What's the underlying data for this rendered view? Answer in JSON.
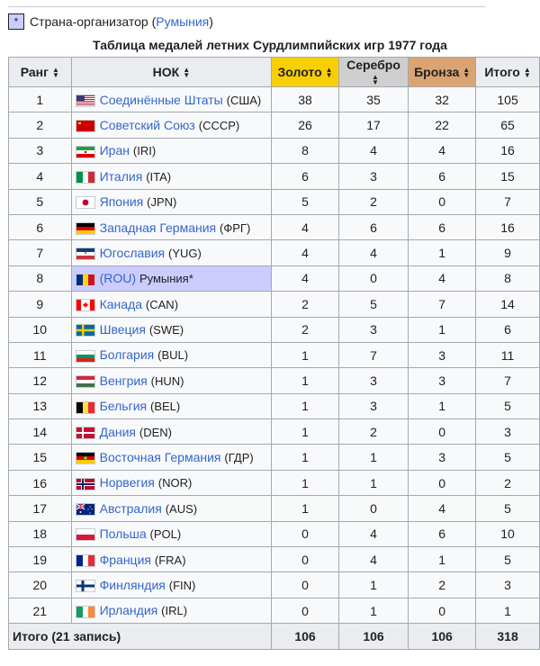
{
  "legend": {
    "symbol": "*",
    "text": "Страна-организатор (",
    "link": "Румыния",
    "close": ")"
  },
  "caption": "Таблица медалей летних Сурдлимпийских игр 1977 года",
  "headers": {
    "rank": "Ранг",
    "noc": "НОК",
    "gold": "Золото",
    "silver": "Серебро",
    "bronze": "Бронза",
    "total": "Итого"
  },
  "colors": {
    "gold": "#f7cf02",
    "silver": "#cfcfcf",
    "bronze": "#d9a472",
    "host": "#ccccff",
    "link": "#3366cc"
  },
  "rows": [
    {
      "rank": "1",
      "name": "Соединённые Штаты",
      "code": "(США)",
      "flag": "flag-usa",
      "gold": "38",
      "silver": "35",
      "bronze": "32",
      "total": "105"
    },
    {
      "rank": "2",
      "name": "Советский Союз",
      "code": "(СССР)",
      "flag": "flag-ussr",
      "gold": "26",
      "silver": "17",
      "bronze": "22",
      "total": "65"
    },
    {
      "rank": "3",
      "name": "Иран",
      "code": "(IRI)",
      "flag": "flag-iran",
      "gold": "8",
      "silver": "4",
      "bronze": "4",
      "total": "16"
    },
    {
      "rank": "4",
      "name": "Италия",
      "code": "(ITA)",
      "flag": "flag-italy",
      "gold": "6",
      "silver": "3",
      "bronze": "6",
      "total": "15"
    },
    {
      "rank": "5",
      "name": "Япония",
      "code": "(JPN)",
      "flag": "flag-japan",
      "gold": "5",
      "silver": "2",
      "bronze": "0",
      "total": "7"
    },
    {
      "rank": "6",
      "name": "Западная Германия",
      "code": "(ФРГ)",
      "flag": "flag-west-germany",
      "gold": "4",
      "silver": "6",
      "bronze": "6",
      "total": "16"
    },
    {
      "rank": "7",
      "name": "Югославия",
      "code": "(YUG)",
      "flag": "flag-yugoslavia",
      "gold": "4",
      "silver": "4",
      "bronze": "1",
      "total": "9"
    },
    {
      "rank": "8",
      "name": "(ROU)",
      "code": "Румыния*",
      "flag": "flag-romania",
      "gold": "4",
      "silver": "0",
      "bronze": "4",
      "total": "8",
      "host": true
    },
    {
      "rank": "9",
      "name": "Канада",
      "code": "(CAN)",
      "flag": "flag-canada",
      "gold": "2",
      "silver": "5",
      "bronze": "7",
      "total": "14"
    },
    {
      "rank": "10",
      "name": "Швеция",
      "code": "(SWE)",
      "flag": "flag-sweden",
      "gold": "2",
      "silver": "3",
      "bronze": "1",
      "total": "6"
    },
    {
      "rank": "11",
      "name": "Болгария",
      "code": "(BUL)",
      "flag": "flag-bulgaria",
      "gold": "1",
      "silver": "7",
      "bronze": "3",
      "total": "11"
    },
    {
      "rank": "12",
      "name": "Венгрия",
      "code": "(HUN)",
      "flag": "flag-hungary",
      "gold": "1",
      "silver": "3",
      "bronze": "3",
      "total": "7"
    },
    {
      "rank": "13",
      "name": "Бельгия",
      "code": "(BEL)",
      "flag": "flag-belgium",
      "gold": "1",
      "silver": "3",
      "bronze": "1",
      "total": "5"
    },
    {
      "rank": "14",
      "name": "Дания",
      "code": "(DEN)",
      "flag": "flag-denmark",
      "gold": "1",
      "silver": "2",
      "bronze": "0",
      "total": "3"
    },
    {
      "rank": "15",
      "name": "Восточная Германия",
      "code": "(ГДР)",
      "flag": "flag-east-germany",
      "gold": "1",
      "silver": "1",
      "bronze": "3",
      "total": "5"
    },
    {
      "rank": "16",
      "name": "Норвегия",
      "code": "(NOR)",
      "flag": "flag-norway",
      "gold": "1",
      "silver": "1",
      "bronze": "0",
      "total": "2"
    },
    {
      "rank": "17",
      "name": "Австралия",
      "code": "(AUS)",
      "flag": "flag-australia",
      "gold": "1",
      "silver": "0",
      "bronze": "4",
      "total": "5"
    },
    {
      "rank": "18",
      "name": "Польша",
      "code": "(POL)",
      "flag": "flag-poland",
      "gold": "0",
      "silver": "4",
      "bronze": "6",
      "total": "10"
    },
    {
      "rank": "19",
      "name": "Франция",
      "code": "(FRA)",
      "flag": "flag-france",
      "gold": "0",
      "silver": "4",
      "bronze": "1",
      "total": "5"
    },
    {
      "rank": "20",
      "name": "Финляндия",
      "code": "(FIN)",
      "flag": "flag-finland",
      "gold": "0",
      "silver": "1",
      "bronze": "2",
      "total": "3"
    },
    {
      "rank": "21",
      "name": "Ирландия",
      "code": "(IRL)",
      "flag": "flag-ireland",
      "gold": "0",
      "silver": "1",
      "bronze": "0",
      "total": "1"
    }
  ],
  "totals": {
    "label": "Итого (21 запись)",
    "gold": "106",
    "silver": "106",
    "bronze": "106",
    "total": "318"
  }
}
